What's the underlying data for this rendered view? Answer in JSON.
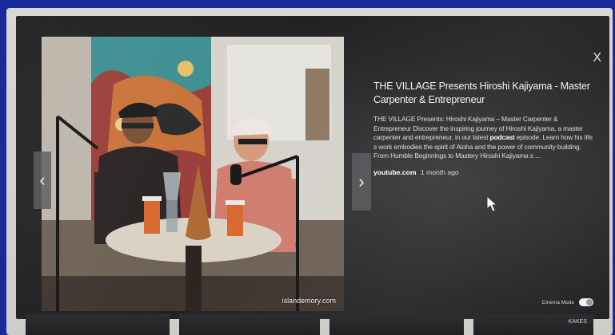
{
  "lightbox": {
    "title": "THE VILLAGE Presents Hiroshi Kajiyama - Master Carpenter & Entrepreneur",
    "description_parts": {
      "before_bold": "THE VILLAGE Presents: Hiroshi Kajiyama – Master Carpenter & Entrepreneur Discover the inspiring journey of Hiroshi Kajiyama, a master carpenter and entrepreneur, in our latest ",
      "bold": "podcast",
      "after_bold": " episode. Learn how his life s work embodies the spirit of Aloha and the power of community building. From Humble Beginnings to Mastery Hiroshi Kajiyama s ..."
    },
    "source": "youtube.com",
    "age": "1 month ago",
    "image_watermark": "islandemory.com",
    "close_label": "X",
    "prev_label": "‹",
    "next_label": "›",
    "cinema_mode_label": "Cinema Mode",
    "thumbnail_text": "KAKES"
  },
  "colors": {
    "outer_frame": "#1a2a9a",
    "bezel": "#d9d7d3",
    "overlay_bg": "#262628",
    "text_primary": "#f4f4f4"
  },
  "icons": {
    "close": "close-icon",
    "prev": "chevron-left-icon",
    "next": "chevron-right-icon",
    "cursor": "mouse-cursor-icon"
  }
}
